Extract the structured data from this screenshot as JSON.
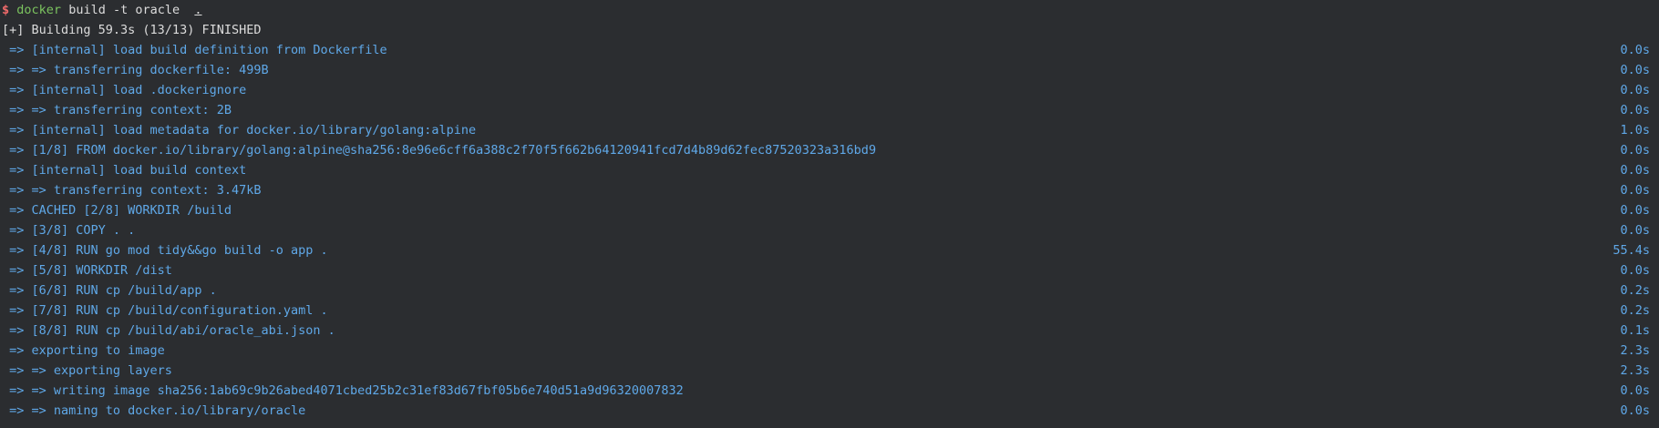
{
  "prompt": {
    "symbol": "$",
    "command": "docker",
    "args": " build -t oracle  ",
    "context_dot": "."
  },
  "header": "[+] Building 59.3s (13/13) FINISHED",
  "steps": [
    {
      "text": " => [internal] load build definition from Dockerfile",
      "time": "0.0s"
    },
    {
      "text": " => => transferring dockerfile: 499B",
      "time": "0.0s"
    },
    {
      "text": " => [internal] load .dockerignore",
      "time": "0.0s"
    },
    {
      "text": " => => transferring context: 2B",
      "time": "0.0s"
    },
    {
      "text": " => [internal] load metadata for docker.io/library/golang:alpine",
      "time": "1.0s"
    },
    {
      "text": " => [1/8] FROM docker.io/library/golang:alpine@sha256:8e96e6cff6a388c2f70f5f662b64120941fcd7d4b89d62fec87520323a316bd9",
      "time": "0.0s"
    },
    {
      "text": " => [internal] load build context",
      "time": "0.0s"
    },
    {
      "text": " => => transferring context: 3.47kB",
      "time": "0.0s"
    },
    {
      "text": " => CACHED [2/8] WORKDIR /build",
      "time": "0.0s"
    },
    {
      "text": " => [3/8] COPY . .",
      "time": "0.0s"
    },
    {
      "text": " => [4/8] RUN go mod tidy&&go build -o app .",
      "time": "55.4s"
    },
    {
      "text": " => [5/8] WORKDIR /dist",
      "time": "0.0s"
    },
    {
      "text": " => [6/8] RUN cp /build/app .",
      "time": "0.2s"
    },
    {
      "text": " => [7/8] RUN cp /build/configuration.yaml .",
      "time": "0.2s"
    },
    {
      "text": " => [8/8] RUN cp /build/abi/oracle_abi.json .",
      "time": "0.1s"
    },
    {
      "text": " => exporting to image",
      "time": "2.3s"
    },
    {
      "text": " => => exporting layers",
      "time": "2.3s"
    },
    {
      "text": " => => writing image sha256:1ab69c9b26abed4071cbed25b2c31ef83d67fbf05b6e740d51a9d96320007832",
      "time": "0.0s"
    },
    {
      "text": " => => naming to docker.io/library/oracle",
      "time": "0.0s"
    }
  ],
  "colors": {
    "background": "#2b2d30",
    "prompt": "#f26b6b",
    "command": "#7bc35f",
    "step": "#5fa8e8",
    "text": "#dcdcdc"
  }
}
